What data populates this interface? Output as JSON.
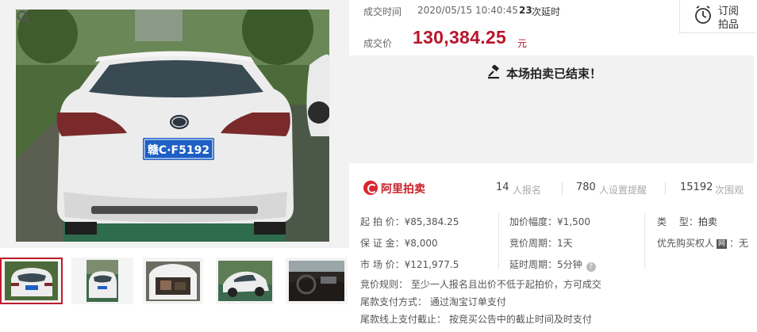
{
  "gallery": {
    "main_image_alt": "白色雷克萨斯CT200h车尾",
    "plate_text": "赣C·F5192",
    "zoom_icon": "magnifier-icon",
    "thumbnails": [
      {
        "name": "thumb-rear",
        "selected": true
      },
      {
        "name": "thumb-rear-side",
        "selected": false
      },
      {
        "name": "thumb-trunk",
        "selected": false
      },
      {
        "name": "thumb-side",
        "selected": false
      },
      {
        "name": "thumb-interior",
        "selected": false
      }
    ]
  },
  "deal": {
    "time_label": "成交时间",
    "time_value": "2020/05/15 10:40:45",
    "delay_count": "23",
    "delay_label": "次延时",
    "price_label": "成交价",
    "price_value": "130,384.25",
    "price_unit": "元"
  },
  "subscribe": {
    "line1": "订阅",
    "line2": "拍品",
    "icon": "alarm-clock-icon"
  },
  "status": {
    "ended_text": "本场拍卖已结束！",
    "icon": "gavel-icon"
  },
  "stats": {
    "brand": "阿里拍卖",
    "signups_num": "14",
    "signups_label": "人报名",
    "reminders_num": "780",
    "reminders_label": "人设置提醒",
    "views_num": "15192",
    "views_label": "次围观"
  },
  "details": {
    "start_price": "起 拍 价：¥85,384.25",
    "deposit": "保 证 金：¥8,000",
    "market_price": "市 场 价：¥121,977.5",
    "increment": "加价幅度：¥1,500",
    "bid_cycle": "竞价周期：1天",
    "delay_cycle": "延时周期：5分钟",
    "type_label": "类　 型：",
    "type_value": "拍卖",
    "priority_label": "优先购买权人",
    "priority_badge": "网",
    "priority_value": "：无"
  },
  "rules": {
    "bidding_rule": "竞价规则：  至少一人报名且出价不低于起拍价，方可成交",
    "final_payment": "尾款支付方式：  通过淘宝订单支付",
    "final_deadline": "尾款线上支付截止：  按竞买公告中的截止时间及时支付"
  },
  "colors": {
    "price_red": "#b8162b",
    "brand_red": "#c8222a",
    "panel_gray": "#f2f2f2"
  }
}
